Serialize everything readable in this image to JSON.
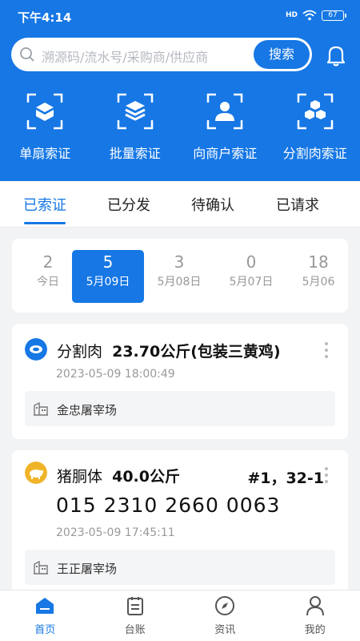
{
  "status": {
    "time": "下午4:14",
    "signal": "HD",
    "battery": "67"
  },
  "search": {
    "placeholder": "溯源码/流水号/采购商/供应商",
    "button": "搜索"
  },
  "actions": [
    {
      "label": "单扇索证",
      "icon": "box-scan-icon"
    },
    {
      "label": "批量索证",
      "icon": "layers-scan-icon"
    },
    {
      "label": "向商户索证",
      "icon": "user-scan-icon"
    },
    {
      "label": "分割肉索证",
      "icon": "cubes-scan-icon"
    }
  ],
  "tabs": [
    "已索证",
    "已分发",
    "待确认",
    "已请求"
  ],
  "active_tab": "已索证",
  "dates": [
    {
      "count": "2",
      "label": "今日"
    },
    {
      "count": "5",
      "label": "5月09日"
    },
    {
      "count": "3",
      "label": "5月08日"
    },
    {
      "count": "0",
      "label": "5月07日"
    },
    {
      "count": "18",
      "label": "5月06"
    }
  ],
  "records": [
    {
      "type": "分割肉",
      "weight": "23.70公斤(包装三黄鸡)",
      "time": "2023-05-09 18:00:49",
      "location": "金忠屠宰场",
      "badge_color": "#1677e5"
    },
    {
      "type": "猪胴体",
      "weight": "40.0公斤",
      "tag": "#1，32-1",
      "code": "015 2310 2660 0063",
      "time": "2023-05-09 17:45:11",
      "location": "王正屠宰场",
      "badge_color": "#f0b429"
    }
  ],
  "nav": [
    {
      "label": "首页",
      "icon": "home-icon"
    },
    {
      "label": "台账",
      "icon": "ledger-icon"
    },
    {
      "label": "资讯",
      "icon": "compass-icon"
    },
    {
      "label": "我的",
      "icon": "person-icon"
    }
  ],
  "colors": {
    "primary": "#1677e5",
    "background": "#f2f3f5"
  }
}
